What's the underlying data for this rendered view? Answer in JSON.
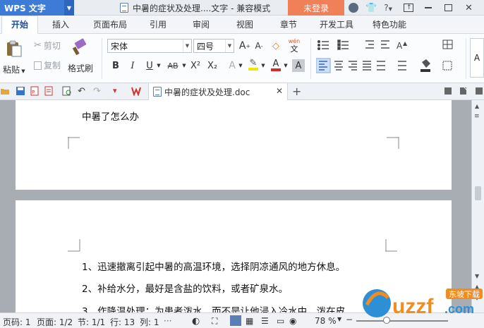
{
  "titlebar": {
    "app_name": "WPS 文字",
    "doc_title": "中暑的症状及处理....文字 - 兼容模式",
    "login_label": "未登录",
    "help_label": "?"
  },
  "ribbon_tabs": [
    "开始",
    "插入",
    "页面布局",
    "引用",
    "审阅",
    "视图",
    "章节",
    "开发工具",
    "特色功能"
  ],
  "ribbon": {
    "paste": "粘贴",
    "cut": "剪切",
    "copy": "复制",
    "format_painter": "格式刷",
    "font_name": "宋体",
    "font_size": "四号",
    "phonetic_top": "wén",
    "phonetic_bottom": "文",
    "bold": "B",
    "italic": "I",
    "underline": "U",
    "strike": "AB",
    "superscript": "X²",
    "subscript": "X₂"
  },
  "doc_tab": {
    "label": "中暑的症状及处理.doc"
  },
  "document": {
    "page1_text": "中暑了怎么办",
    "lines": [
      "1、迅速撤离引起中暑的高温环境，选择阴凉通风的地方休息。",
      "2、补给水分，最好是含盐的饮料，或者矿泉水。",
      "3、作降温处理：为患者泼水，而不是让他浸入冷水中。泼在皮"
    ]
  },
  "statusbar": {
    "page_code": "页码: 1",
    "pages": "页面: 1/2",
    "section": "节: 1/1",
    "row": "行: 13",
    "col": "列: 1",
    "zoom": "78 %"
  },
  "zoom_level": 0.33,
  "watermark": {
    "brand": "uzzf",
    "domain": ".com",
    "subtitle": "东坡下载"
  },
  "colors": {
    "app_blue": "#3e7bd6",
    "login_orange": "#f08057",
    "watermark_orange": "#f28c1e",
    "watermark_blue": "#2d8fd6"
  }
}
